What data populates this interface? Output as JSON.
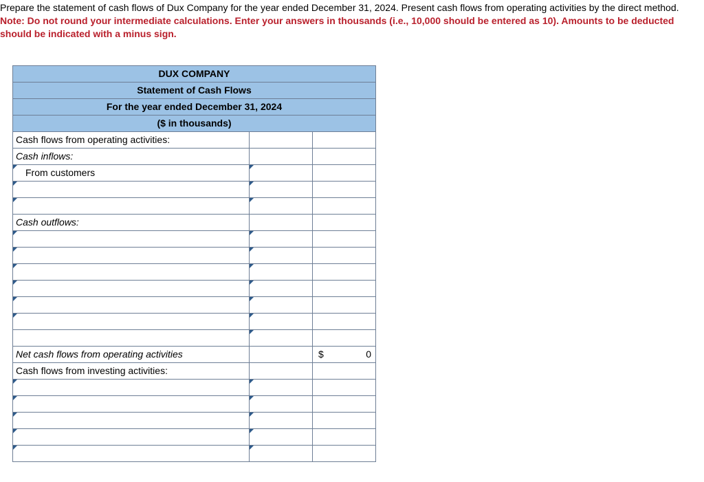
{
  "instructions": {
    "line1": "Prepare the statement of cash flows of Dux Company for the year ended December 31, 2024. Present cash flows from operating activities by the direct method.",
    "note": "Note: Do not round your intermediate calculations. Enter your answers in thousands (i.e., 10,000 should be entered as 10). Amounts to be deducted should be indicated with a minus sign."
  },
  "header": {
    "company": "DUX COMPANY",
    "title": "Statement of Cash Flows",
    "period": "For the year ended December 31, 2024",
    "units": "($ in thousands)"
  },
  "labels": {
    "op_activities": "Cash flows from operating activities:",
    "cash_inflows": "Cash inflows:",
    "from_customers": "From customers",
    "cash_outflows": "Cash outflows:",
    "net_op": "Net cash flows from operating activities",
    "inv_activities": "Cash flows from investing activities:"
  },
  "values": {
    "net_op_symbol": "$",
    "net_op_amount": "0"
  }
}
